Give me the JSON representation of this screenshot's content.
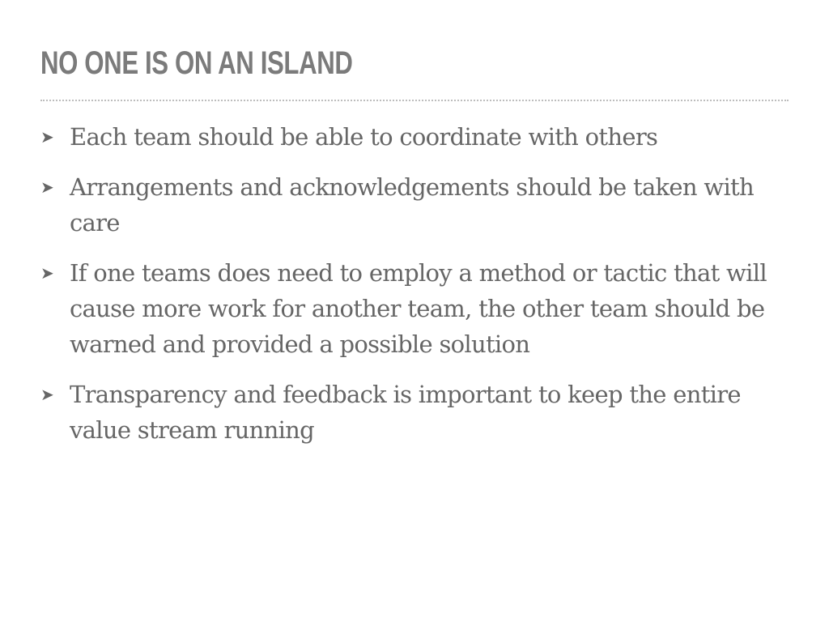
{
  "slide": {
    "title": "NO ONE IS ON AN ISLAND",
    "bullet_marker": "➤",
    "bullets": [
      "Each team should be able to coordinate with others",
      "Arrangements and acknowledgements should be taken with care",
      "If one teams does need to employ a method or tactic that will cause more work for another team, the other team should be warned and provided a possible solution",
      "Transparency and feedback is important to keep the entire value stream running"
    ]
  },
  "colors": {
    "title": "#7b7b7b",
    "body_text": "#666666",
    "rule": "#bdbdbd",
    "background": "#ffffff"
  }
}
